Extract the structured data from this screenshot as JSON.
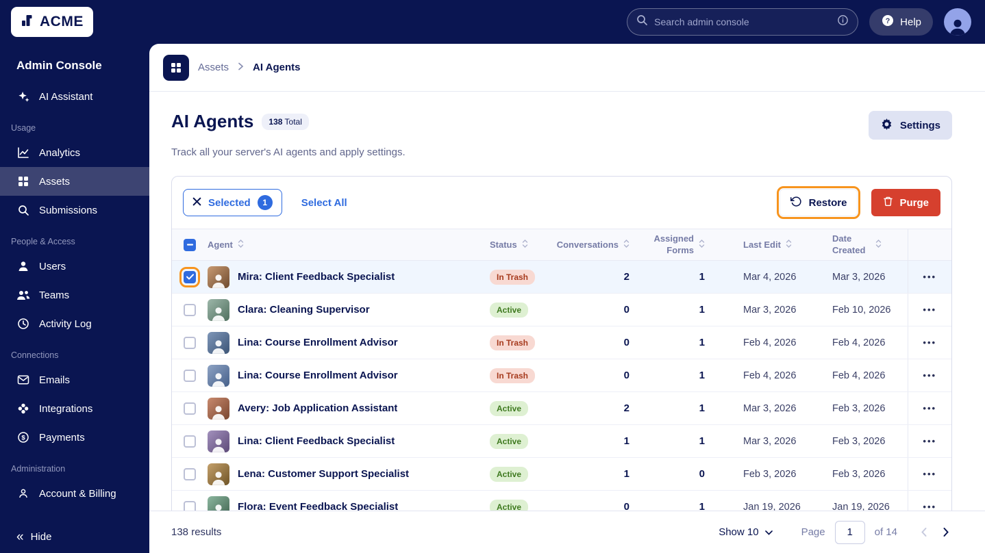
{
  "topbar": {
    "logo_text": "ACME",
    "search_placeholder": "Search admin console",
    "help_label": "Help"
  },
  "sidebar": {
    "title": "Admin Console",
    "hide_label": "Hide",
    "sections": [
      {
        "label": "",
        "items": [
          {
            "label": "AI Assistant",
            "icon": "sparkles-icon",
            "active": false
          }
        ]
      },
      {
        "label": "Usage",
        "items": [
          {
            "label": "Analytics",
            "icon": "chart-icon",
            "active": false
          },
          {
            "label": "Assets",
            "icon": "grid-icon",
            "active": true
          },
          {
            "label": "Submissions",
            "icon": "search-icon",
            "active": false
          }
        ]
      },
      {
        "label": "People & Access",
        "items": [
          {
            "label": "Users",
            "icon": "user-icon",
            "active": false
          },
          {
            "label": "Teams",
            "icon": "users-icon",
            "active": false
          },
          {
            "label": "Activity Log",
            "icon": "clock-icon",
            "active": false
          }
        ]
      },
      {
        "label": "Connections",
        "items": [
          {
            "label": "Emails",
            "icon": "mail-icon",
            "active": false
          },
          {
            "label": "Integrations",
            "icon": "puzzle-icon",
            "active": false
          },
          {
            "label": "Payments",
            "icon": "payments-icon",
            "active": false
          }
        ]
      },
      {
        "label": "Administration",
        "items": [
          {
            "label": "Account & Billing",
            "icon": "account-icon",
            "active": false
          }
        ]
      }
    ]
  },
  "breadcrumb": {
    "root": "Assets",
    "current": "AI Agents"
  },
  "page": {
    "title": "AI Agents",
    "total_count": "138",
    "total_label": "Total",
    "subtitle": "Track all your server's AI agents and apply settings.",
    "settings_label": "Settings"
  },
  "toolbar": {
    "selected_label": "Selected",
    "selected_count": "1",
    "select_all_label": "Select All",
    "restore_label": "Restore",
    "purge_label": "Purge"
  },
  "table": {
    "columns": [
      "Agent",
      "Status",
      "Conversations",
      "Assigned Forms",
      "Last Edit",
      "Date Created"
    ],
    "rows": [
      {
        "name": "Mira: Client Feedback Specialist",
        "status": "In Trash",
        "status_type": "trash",
        "conversations": "2",
        "assigned_forms": "1",
        "last_edit": "Mar 4, 2026",
        "date_created": "Mar 3, 2026",
        "selected": true
      },
      {
        "name": "Clara: Cleaning Supervisor",
        "status": "Active",
        "status_type": "active",
        "conversations": "0",
        "assigned_forms": "1",
        "last_edit": "Mar 3, 2026",
        "date_created": "Feb 10, 2026",
        "selected": false
      },
      {
        "name": "Lina: Course Enrollment Advisor",
        "status": "In Trash",
        "status_type": "trash",
        "conversations": "0",
        "assigned_forms": "1",
        "last_edit": "Feb 4, 2026",
        "date_created": "Feb 4, 2026",
        "selected": false
      },
      {
        "name": "Lina: Course Enrollment Advisor",
        "status": "In Trash",
        "status_type": "trash",
        "conversations": "0",
        "assigned_forms": "1",
        "last_edit": "Feb 4, 2026",
        "date_created": "Feb 4, 2026",
        "selected": false
      },
      {
        "name": "Avery: Job Application Assistant",
        "status": "Active",
        "status_type": "active",
        "conversations": "2",
        "assigned_forms": "1",
        "last_edit": "Mar 3, 2026",
        "date_created": "Feb 3, 2026",
        "selected": false
      },
      {
        "name": "Lina: Client Feedback Specialist",
        "status": "Active",
        "status_type": "active",
        "conversations": "1",
        "assigned_forms": "1",
        "last_edit": "Mar 3, 2026",
        "date_created": "Feb 3, 2026",
        "selected": false
      },
      {
        "name": "Lena: Customer Support Specialist",
        "status": "Active",
        "status_type": "active",
        "conversations": "1",
        "assigned_forms": "0",
        "last_edit": "Feb 3, 2026",
        "date_created": "Feb 3, 2026",
        "selected": false
      },
      {
        "name": "Flora: Event Feedback Specialist",
        "status": "Active",
        "status_type": "active",
        "conversations": "0",
        "assigned_forms": "1",
        "last_edit": "Jan 19, 2026",
        "date_created": "Jan 19, 2026",
        "selected": false
      }
    ]
  },
  "footer": {
    "results": "138 results",
    "show_label": "Show 10",
    "page_label": "Page",
    "page_value": "1",
    "of_label": "of 14"
  },
  "colors": {
    "navy": "#0a1551",
    "accent_blue": "#2f6bdf",
    "annotation_orange": "#f7941e",
    "danger_red": "#d6402e",
    "active_badge_bg": "#def0d2",
    "active_badge_text": "#3f7a20",
    "trash_badge_bg": "#f8d9d2",
    "trash_badge_text": "#a63a1d",
    "selected_row_bg": "#f0f6fe"
  }
}
